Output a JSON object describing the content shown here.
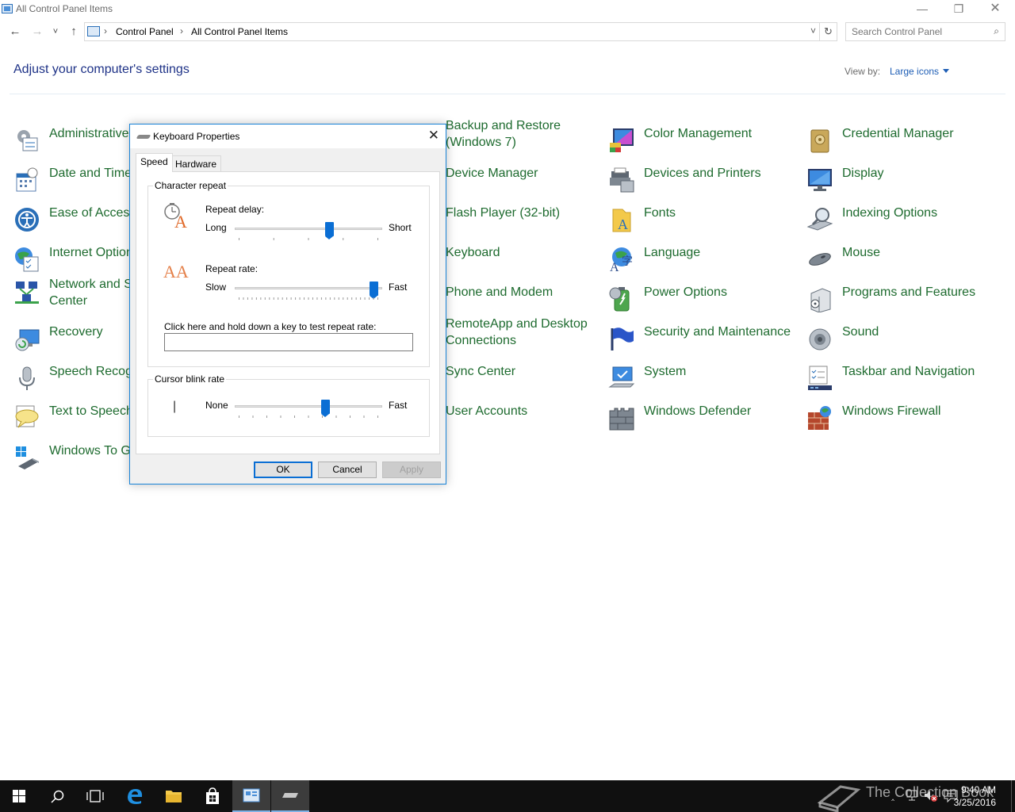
{
  "window": {
    "title": "All Control Panel Items",
    "minimize": "—",
    "restore": "❐",
    "close": "✕"
  },
  "navigation": {
    "back": "←",
    "forward": "→",
    "recent": "˅",
    "up": "↑",
    "breadcrumb": [
      "Control Panel",
      "All Control Panel Items"
    ],
    "separator": "›",
    "address_dropdown": "˅",
    "refresh": "↻",
    "search_placeholder": "Search Control Panel",
    "search_glyph": "⌕"
  },
  "header": {
    "title": "Adjust your computer's settings",
    "view_by_label": "View by:",
    "view_by_value": "Large icons"
  },
  "items": [
    [
      "Administrative",
      "Backup and Restore (Windows 7)",
      "Color Management",
      "Credential Manager"
    ],
    [
      "Date and Time",
      "Device Manager",
      "Devices and Printers",
      "Display"
    ],
    [
      "Ease of Access",
      "Flash Player (32-bit)",
      "Fonts",
      "Indexing Options"
    ],
    [
      "Internet Option",
      "Keyboard",
      "Language",
      "Mouse"
    ],
    [
      "Network and S Center",
      "Phone and Modem",
      "Power Options",
      "Programs and Features"
    ],
    [
      "Recovery",
      "RemoteApp and Desktop Connections",
      "Security and Maintenance",
      "Sound"
    ],
    [
      "Speech Recogn",
      "Sync Center",
      "System",
      "Taskbar and Navigation"
    ],
    [
      "Text to Speech",
      "User Accounts",
      "Windows Defender",
      "Windows Firewall"
    ],
    [
      "Windows To Go"
    ]
  ],
  "item_labels": {
    "c0": [
      "Administrative",
      "Date and Time",
      "Ease of Access",
      "Internet Option",
      "Network and S",
      "Recovery",
      "Speech Recogn",
      "Text to Speech",
      "Windows To Go"
    ],
    "c0_network_line2": "Center",
    "c1": [
      "Backup and Restore",
      "Device Manager",
      "Flash Player (32-bit)",
      "Keyboard",
      "Phone and Modem",
      "RemoteApp and Desktop",
      "Sync Center",
      "User Accounts"
    ],
    "c1_backup_line2": "(Windows 7)",
    "c1_remote_line2": "Connections",
    "c2": [
      "Color Management",
      "Devices and Printers",
      "Fonts",
      "Language",
      "Power Options",
      "Security and Maintenance",
      "System",
      "Windows Defender"
    ],
    "c3": [
      "Credential Manager",
      "Display",
      "Indexing Options",
      "Mouse",
      "Programs and Features",
      "Sound",
      "Taskbar and Navigation",
      "Windows Firewall"
    ]
  },
  "dialog": {
    "title": "Keyboard Properties",
    "close": "✕",
    "tabs": [
      "Speed",
      "Hardware"
    ],
    "char_repeat_group": "Character repeat",
    "repeat_delay_label": "Repeat delay:",
    "repeat_delay_min": "Long",
    "repeat_delay_max": "Short",
    "repeat_delay_value": 0.65,
    "repeat_rate_label": "Repeat rate:",
    "repeat_rate_min": "Slow",
    "repeat_rate_max": "Fast",
    "repeat_rate_value": 0.97,
    "test_label": "Click here and hold down a key to test repeat rate:",
    "test_value": "",
    "cursor_group": "Cursor blink rate",
    "cursor_min": "None",
    "cursor_max": "Fast",
    "cursor_value": 0.62,
    "cursor_glyph": "|",
    "font_glyph_a": "A",
    "font_glyph_aa": "AA",
    "ok": "OK",
    "cancel": "Cancel",
    "apply": "Apply"
  },
  "taskbar": {
    "time": "9:40 AM",
    "date": "3/25/2016",
    "watermark": "The Collection Book"
  }
}
